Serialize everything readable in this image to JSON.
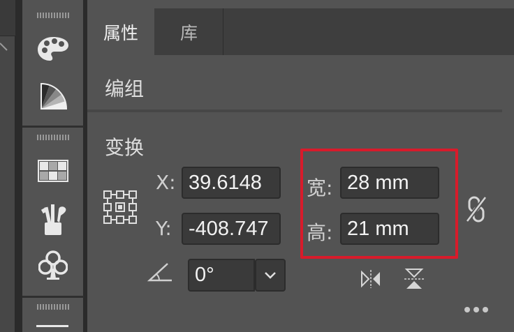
{
  "tabs": [
    {
      "label": "属性"
    },
    {
      "label": "库"
    }
  ],
  "group_section": {
    "label": "编组"
  },
  "transform": {
    "title": "变换",
    "x_label": "X:",
    "x_value": "39.6148",
    "y_label": "Y:",
    "y_value": "-408.747",
    "width_label": "宽:",
    "width_value": "28 mm",
    "height_label": "高:",
    "height_value": "21 mm",
    "angle_value": "0°"
  },
  "colors": {
    "panel_bg": "#535353",
    "field_bg": "#3a3a3a",
    "highlight": "#d81b2b"
  },
  "icons": {
    "tools": [
      "palette-icon",
      "color-guide-icon",
      "swatches-grid-icon",
      "brushes-icon",
      "symbols-club-icon"
    ],
    "transform": [
      "reference-point-icon",
      "angle-icon",
      "chevron-down-icon",
      "link-proportions-icon",
      "flip-horizontal-icon",
      "flip-vertical-icon",
      "more-options-icon"
    ]
  }
}
